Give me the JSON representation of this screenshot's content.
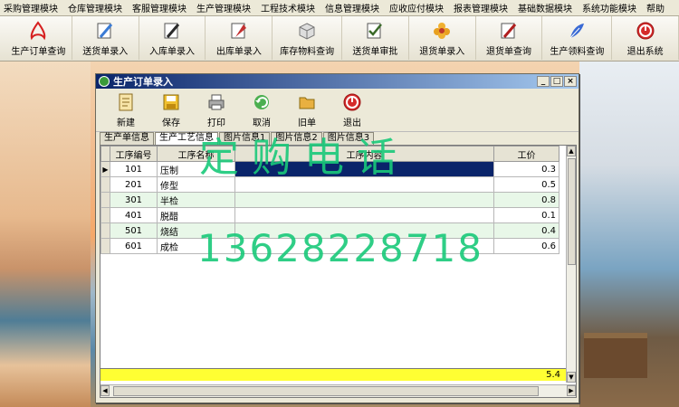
{
  "menu": [
    "采购管理模块",
    "仓库管理模块",
    "客服管理模块",
    "生产管理模块",
    "工程技术模块",
    "信息管理模块",
    "应收应付模块",
    "报表管理模块",
    "基础数据模块",
    "系统功能模块",
    "帮助"
  ],
  "toolbar": [
    {
      "label": "生产订单查询",
      "icon": "pdf-icon",
      "color": "#d62020"
    },
    {
      "label": "送货单录入",
      "icon": "pen-icon",
      "color": "#3a7bd5"
    },
    {
      "label": "入库单录入",
      "icon": "pen-icon",
      "color": "#2a2a2a"
    },
    {
      "label": "出库单录入",
      "icon": "flag-icon",
      "color": "#c23030"
    },
    {
      "label": "库存物料查询",
      "icon": "cube-icon",
      "color": "#7a7a7a"
    },
    {
      "label": "送货单审批",
      "icon": "check-icon",
      "color": "#3b6b2a"
    },
    {
      "label": "退货单录入",
      "icon": "flower-icon",
      "color": "#e8a020"
    },
    {
      "label": "退货单查询",
      "icon": "pen-icon",
      "color": "#b01e1e"
    },
    {
      "label": "生产领料查询",
      "icon": "feather-icon",
      "color": "#3a6ad4"
    },
    {
      "label": "退出系统",
      "icon": "power-icon",
      "color": "#d52b2b"
    }
  ],
  "window": {
    "title": "生产订单录入",
    "buttons": [
      "新建",
      "保存",
      "打印",
      "取消",
      "旧单",
      "退出"
    ]
  },
  "tabs": [
    "生产单信息",
    "生产工艺信息",
    "图片信息1",
    "图片信息2",
    "图片信息3"
  ],
  "grid": {
    "headers": [
      "工序编号",
      "工序名称",
      "工序内容",
      "工价"
    ],
    "rows": [
      {
        "code": "101",
        "name": "压制",
        "content": "",
        "price": "0.3"
      },
      {
        "code": "201",
        "name": "修型",
        "content": "",
        "price": "0.5"
      },
      {
        "code": "301",
        "name": "半检",
        "content": "",
        "price": "0.8"
      },
      {
        "code": "401",
        "name": "脱醋",
        "content": "",
        "price": "0.1"
      },
      {
        "code": "501",
        "name": "烧结",
        "content": "",
        "price": "0.4"
      },
      {
        "code": "601",
        "name": "成检",
        "content": "",
        "price": "0.6"
      }
    ],
    "total": "5.4"
  },
  "watermark": {
    "line1": "定购电话",
    "line2": "13628228718"
  }
}
